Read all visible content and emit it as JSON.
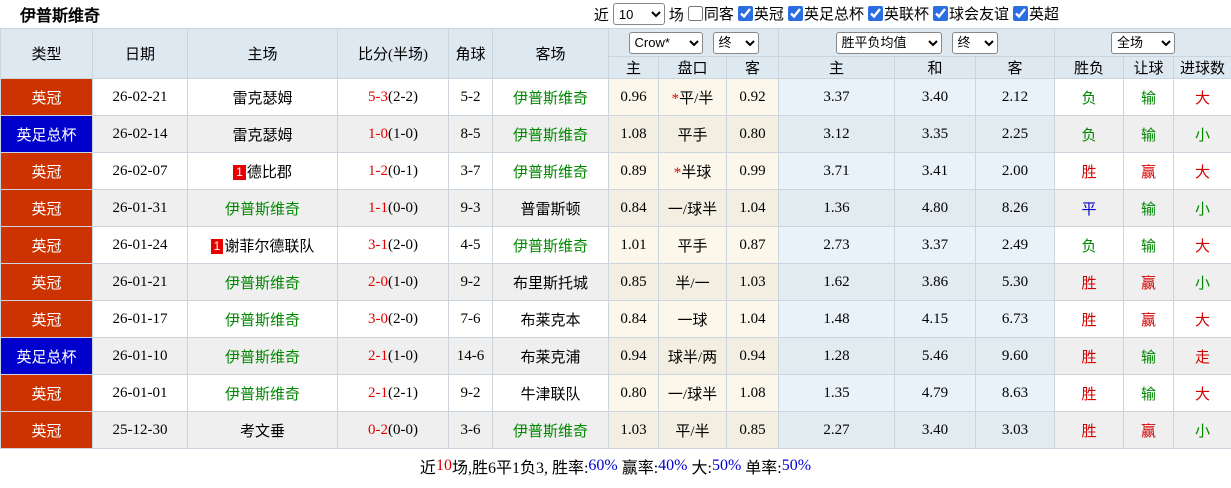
{
  "colors": {
    "red": "#d40000",
    "green": "#008800",
    "blue": "#0000cc",
    "black": "#000000"
  },
  "header": {
    "title": "伊普斯维奇",
    "recent_label": "近",
    "matches_label": "场",
    "count_select": "10",
    "checkboxes": [
      {
        "label": "同客",
        "checked": false
      },
      {
        "label": "英冠",
        "checked": true
      },
      {
        "label": "英足总杯",
        "checked": true
      },
      {
        "label": "英联杯",
        "checked": true
      },
      {
        "label": "球会友谊",
        "checked": true
      },
      {
        "label": "英超",
        "checked": true
      }
    ]
  },
  "table": {
    "columns": [
      "类型",
      "日期",
      "主场",
      "比分(半场)",
      "角球",
      "客场"
    ],
    "selects": {
      "company": "Crow*",
      "company_time": "终",
      "avg": "胜平负均值",
      "avg_time": "终",
      "scope": "全场"
    },
    "sub_columns": [
      "主",
      "盘口",
      "客",
      "主",
      "和",
      "客",
      "胜负",
      "让球",
      "进球数"
    ],
    "rows": [
      {
        "league": "英冠",
        "league_color": "red",
        "date": "26-02-21",
        "home": "雷克瑟姆",
        "home_rank": "",
        "home_highlight": false,
        "score_ft": "5-3",
        "score_ht": "(2-2)",
        "corners": "5-2",
        "away": "伊普斯维奇",
        "away_highlight": true,
        "odds": [
          "0.96",
          "平/半",
          "0.92"
        ],
        "handicap_star": true,
        "avg": [
          "3.37",
          "3.40",
          "2.12"
        ],
        "result": "负",
        "result_color": "green",
        "cover": "输",
        "cover_color": "green",
        "goals": "大",
        "goals_color": "red"
      },
      {
        "league": "英足总杯",
        "league_color": "blue",
        "date": "26-02-14",
        "home": "雷克瑟姆",
        "home_rank": "",
        "home_highlight": false,
        "score_ft": "1-0",
        "score_ht": "(1-0)",
        "corners": "8-5",
        "away": "伊普斯维奇",
        "away_highlight": true,
        "odds": [
          "1.08",
          "平手",
          "0.80"
        ],
        "handicap_star": false,
        "avg": [
          "3.12",
          "3.35",
          "2.25"
        ],
        "result": "负",
        "result_color": "green",
        "cover": "输",
        "cover_color": "green",
        "goals": "小",
        "goals_color": "green"
      },
      {
        "league": "英冠",
        "league_color": "red",
        "date": "26-02-07",
        "home": "德比郡",
        "home_rank": "1",
        "home_highlight": false,
        "score_ft": "1-2",
        "score_ht": "(0-1)",
        "corners": "3-7",
        "away": "伊普斯维奇",
        "away_highlight": true,
        "odds": [
          "0.89",
          "半球",
          "0.99"
        ],
        "handicap_star": true,
        "avg": [
          "3.71",
          "3.41",
          "2.00"
        ],
        "result": "胜",
        "result_color": "red",
        "cover": "赢",
        "cover_color": "red",
        "goals": "大",
        "goals_color": "red"
      },
      {
        "league": "英冠",
        "league_color": "red",
        "date": "26-01-31",
        "home": "伊普斯维奇",
        "home_rank": "",
        "home_highlight": true,
        "score_ft": "1-1",
        "score_ht": "(0-0)",
        "corners": "9-3",
        "away": "普雷斯顿",
        "away_highlight": false,
        "odds": [
          "0.84",
          "一/球半",
          "1.04"
        ],
        "handicap_star": false,
        "avg": [
          "1.36",
          "4.80",
          "8.26"
        ],
        "result": "平",
        "result_color": "blue",
        "cover": "输",
        "cover_color": "green",
        "goals": "小",
        "goals_color": "green"
      },
      {
        "league": "英冠",
        "league_color": "red",
        "date": "26-01-24",
        "home": "谢菲尔德联队",
        "home_rank": "1",
        "home_highlight": false,
        "score_ft": "3-1",
        "score_ht": "(2-0)",
        "corners": "4-5",
        "away": "伊普斯维奇",
        "away_highlight": true,
        "odds": [
          "1.01",
          "平手",
          "0.87"
        ],
        "handicap_star": false,
        "avg": [
          "2.73",
          "3.37",
          "2.49"
        ],
        "result": "负",
        "result_color": "green",
        "cover": "输",
        "cover_color": "green",
        "goals": "大",
        "goals_color": "red"
      },
      {
        "league": "英冠",
        "league_color": "red",
        "date": "26-01-21",
        "home": "伊普斯维奇",
        "home_rank": "",
        "home_highlight": true,
        "score_ft": "2-0",
        "score_ht": "(1-0)",
        "corners": "9-2",
        "away": "布里斯托城",
        "away_highlight": false,
        "odds": [
          "0.85",
          "半/一",
          "1.03"
        ],
        "handicap_star": false,
        "avg": [
          "1.62",
          "3.86",
          "5.30"
        ],
        "result": "胜",
        "result_color": "red",
        "cover": "赢",
        "cover_color": "red",
        "goals": "小",
        "goals_color": "green"
      },
      {
        "league": "英冠",
        "league_color": "red",
        "date": "26-01-17",
        "home": "伊普斯维奇",
        "home_rank": "",
        "home_highlight": true,
        "score_ft": "3-0",
        "score_ht": "(2-0)",
        "corners": "7-6",
        "away": "布莱克本",
        "away_highlight": false,
        "odds": [
          "0.84",
          "一球",
          "1.04"
        ],
        "handicap_star": false,
        "avg": [
          "1.48",
          "4.15",
          "6.73"
        ],
        "result": "胜",
        "result_color": "red",
        "cover": "赢",
        "cover_color": "red",
        "goals": "大",
        "goals_color": "red"
      },
      {
        "league": "英足总杯",
        "league_color": "blue",
        "date": "26-01-10",
        "home": "伊普斯维奇",
        "home_rank": "",
        "home_highlight": true,
        "score_ft": "2-1",
        "score_ht": "(1-0)",
        "corners": "14-6",
        "away": "布莱克浦",
        "away_highlight": false,
        "odds": [
          "0.94",
          "球半/两",
          "0.94"
        ],
        "handicap_star": false,
        "avg": [
          "1.28",
          "5.46",
          "9.60"
        ],
        "result": "胜",
        "result_color": "red",
        "cover": "输",
        "cover_color": "green",
        "goals": "走",
        "goals_color": "red"
      },
      {
        "league": "英冠",
        "league_color": "red",
        "date": "26-01-01",
        "home": "伊普斯维奇",
        "home_rank": "",
        "home_highlight": true,
        "score_ft": "2-1",
        "score_ht": "(2-1)",
        "corners": "9-2",
        "away": "牛津联队",
        "away_highlight": false,
        "odds": [
          "0.80",
          "一/球半",
          "1.08"
        ],
        "handicap_star": false,
        "avg": [
          "1.35",
          "4.79",
          "8.63"
        ],
        "result": "胜",
        "result_color": "red",
        "cover": "输",
        "cover_color": "green",
        "goals": "大",
        "goals_color": "red"
      },
      {
        "league": "英冠",
        "league_color": "red",
        "date": "25-12-30",
        "home": "考文垂",
        "home_rank": "",
        "home_highlight": false,
        "score_ft": "0-2",
        "score_ht": "(0-0)",
        "corners": "3-6",
        "away": "伊普斯维奇",
        "away_highlight": true,
        "odds": [
          "1.03",
          "平/半",
          "0.85"
        ],
        "handicap_star": false,
        "avg": [
          "2.27",
          "3.40",
          "3.03"
        ],
        "result": "胜",
        "result_color": "red",
        "cover": "赢",
        "cover_color": "red",
        "goals": "小",
        "goals_color": "green"
      }
    ]
  },
  "summary": {
    "segments": [
      {
        "text": "近",
        "color": "black"
      },
      {
        "text": "10",
        "color": "red"
      },
      {
        "text": "场,胜6平1负3, 胜率:",
        "color": "black"
      },
      {
        "text": "60%",
        "color": "blue"
      },
      {
        "text": " 赢率:",
        "color": "black"
      },
      {
        "text": "40%",
        "color": "blue"
      },
      {
        "text": " 大:",
        "color": "black"
      },
      {
        "text": "50%",
        "color": "blue"
      },
      {
        "text": " 单率:",
        "color": "black"
      },
      {
        "text": "50%",
        "color": "blue"
      }
    ]
  }
}
